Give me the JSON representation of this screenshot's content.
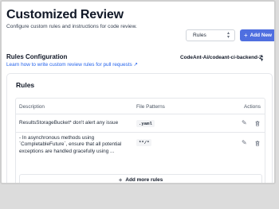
{
  "header": {
    "title": "Customized Review",
    "subtitle": "Configure custom rules and instructions for code review.",
    "select_value": "Rules",
    "add_new_label": "Add New"
  },
  "config": {
    "title": "Rules Configuration",
    "link_text": "Learn how to write custom review rules for pull requests ↗",
    "repo_value": "CodeAnt-Ai/codeant-ci-backend-2"
  },
  "rules": {
    "heading": "Rules",
    "columns": [
      "Description",
      "File Patterns",
      "Actions"
    ],
    "rows": [
      {
        "description": "ResultsStorageBucket* don't alert any issue",
        "pattern": ".yaml"
      },
      {
        "description": "- In asynchronous methods using `CompletableFuture`, ensure that all potential exceptions are handled gracefully using ...",
        "pattern": "**/*"
      }
    ],
    "add_more_label": "Add more rules"
  },
  "icons": {
    "edit": "pencil-icon",
    "delete": "trash-icon",
    "add": "plus-icon",
    "external": "external-link-icon"
  },
  "colors": {
    "accent": "#4f6fe0",
    "link": "#2563eb"
  }
}
